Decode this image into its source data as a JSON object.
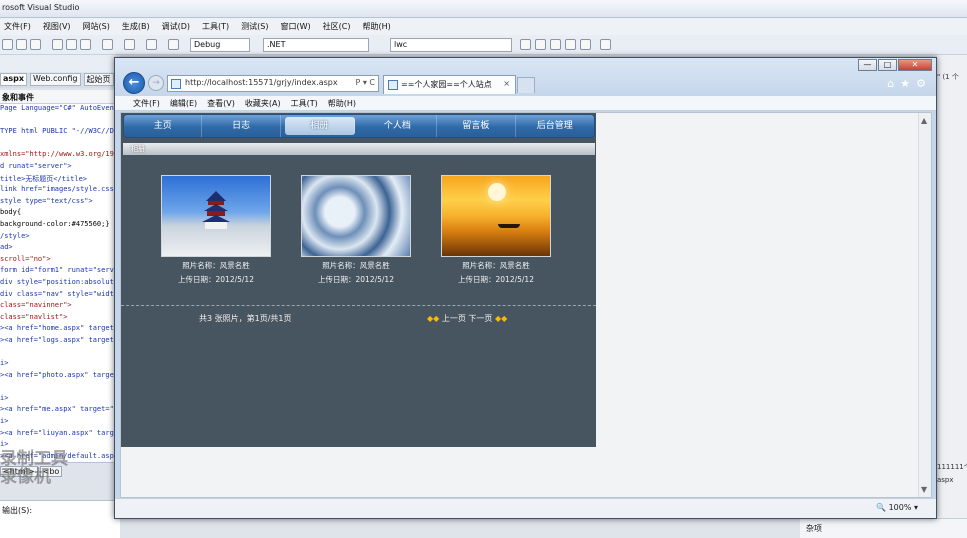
{
  "vs": {
    "title": "rosoft Visual Studio",
    "menu": [
      "文件(F)",
      "视图(V)",
      "网站(S)",
      "生成(B)",
      "调试(D)",
      "工具(T)",
      "测试(S)",
      "窗口(W)",
      "社区(C)",
      "帮助(H)"
    ],
    "config": "Debug",
    "platform": ".NET",
    "search": "lwc",
    "tabs": [
      "aspx",
      "Web.config",
      "起始页"
    ],
    "subheader": "象和事件",
    "code_lines": [
      {
        "t": "Page Language=\"C#\" AutoEventW",
        "c": "b"
      },
      {
        "t": "",
        "c": ""
      },
      {
        "t": "TYPE html PUBLIC \"-//W3C//DT",
        "c": "b"
      },
      {
        "t": "",
        "c": ""
      },
      {
        "t": " xmlns=\"http://www.w3.org/19",
        "c": "r"
      },
      {
        "t": "d runat=\"server\">",
        "c": "b"
      },
      {
        "t": "title>无标题页</title>",
        "c": "b"
      },
      {
        "t": "link href=\"images/style.css\"",
        "c": "b"
      },
      {
        "t": "style type=\"text/css\">",
        "c": "b"
      },
      {
        "t": "body{",
        "c": ""
      },
      {
        "t": "background-color:#475560;}",
        "c": ""
      },
      {
        "t": "/style>",
        "c": "b"
      },
      {
        "t": "ad>",
        "c": "b"
      },
      {
        "t": " scroll=\"no\">",
        "c": "r"
      },
      {
        "t": "form id=\"form1\" runat=\"server",
        "c": "b"
      },
      {
        "t": "div  style=\"position:absolut",
        "c": "b"
      },
      {
        "t": "div class=\"nav\" style=\"width",
        "c": "b"
      },
      {
        "t": " class=\"navinner\">",
        "c": "r"
      },
      {
        "t": "  class=\"navlist\">",
        "c": "r"
      },
      {
        "t": "><a href=\"home.aspx\" target=",
        "c": "b"
      },
      {
        "t": "><a href=\"logs.aspx\" target=",
        "c": "b"
      },
      {
        "t": "",
        "c": ""
      },
      {
        "t": "i>",
        "c": "b"
      },
      {
        "t": "><a href=\"photo.aspx\" target",
        "c": "b"
      },
      {
        "t": "",
        "c": ""
      },
      {
        "t": "i>",
        "c": "b"
      },
      {
        "t": "><a href=\"me.aspx\" target=\"m",
        "c": "b"
      },
      {
        "t": "i>",
        "c": "b"
      },
      {
        "t": "><a href=\"liuyan.aspx\" target",
        "c": "b"
      },
      {
        "t": "i>",
        "c": "b"
      },
      {
        "t": "><a href=\"admin/default.aspx",
        "c": "b"
      }
    ],
    "bottom_tabs": [
      "<html>",
      "<bo"
    ],
    "output_label": "输出(S):",
    "watermark1": "录制工具",
    "watermark2": "录像机",
    "right_panel_text": "杂项",
    "right_snippets": [
      "\" (1 个",
      "111111个",
      "aspx"
    ]
  },
  "ie": {
    "back": "←",
    "forward": "→",
    "address": "http://localhost:15571/grjy/index.aspx",
    "addr_controls": "P ▾ C",
    "tab_title": "==个人家园==个人站点",
    "tab_close": "×",
    "menu": [
      "文件(F)",
      "编辑(E)",
      "查看(V)",
      "收藏夹(A)",
      "工具(T)",
      "帮助(H)"
    ],
    "zoom": "100%",
    "win_min": "—",
    "win_max": "□",
    "win_close": "✕"
  },
  "site": {
    "nav": [
      "主页",
      "日志",
      "相册",
      "个人档",
      "留言板",
      "后台管理"
    ],
    "active_nav_index": 2,
    "breadcrumb": "相册",
    "photos": [
      {
        "name": "照片名称：风景名胜",
        "date": "上传日期：2012/5/12"
      },
      {
        "name": "照片名称：风景名胜",
        "date": "上传日期：2012/5/12"
      },
      {
        "name": "照片名称：风景名胜",
        "date": "上传日期：2012/5/12"
      }
    ],
    "pager_info": "共3 张照片，第1页/共1页",
    "prev_label": "上一页",
    "next_label": "下一页"
  }
}
